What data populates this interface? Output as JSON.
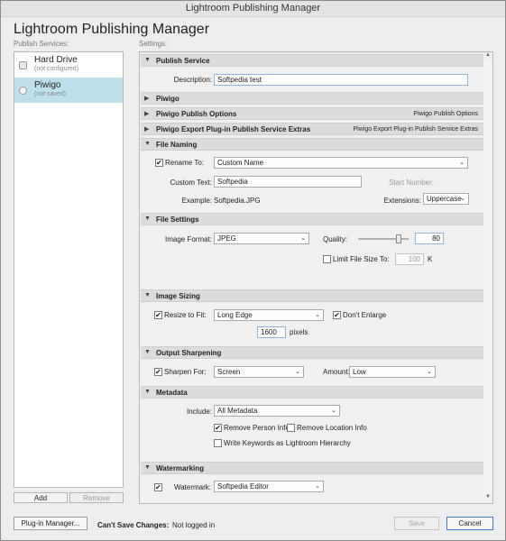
{
  "window": {
    "title": "Lightroom Publishing Manager",
    "close_glyph": "✕"
  },
  "app_title": "Lightroom Publishing Manager",
  "labels": {
    "publish_services": "Publish Services:",
    "settings": "Settings:"
  },
  "services": [
    {
      "name": "Hard Drive",
      "status": "(not configured)"
    },
    {
      "name": "Piwigo",
      "status": "(not saved)"
    }
  ],
  "left_buttons": {
    "add": "Add",
    "remove": "Remove"
  },
  "sections": {
    "publish_service": {
      "title": "Publish Service",
      "description_label": "Description:",
      "description_value": "Softpedia test"
    },
    "piwigo": {
      "title": "Piwigo"
    },
    "piwigo_publish_options": {
      "title": "Piwigo Publish Options",
      "right": "Piwigo Publish Options"
    },
    "piwigo_export_extras": {
      "title": "Piwigo Export Plug-in Publish Service Extras",
      "right": "Piwigo Export Plug-in Publish Service Extras"
    },
    "file_naming": {
      "title": "File Naming",
      "rename_label": "Rename To:",
      "rename_checked": "✔",
      "rename_value": "Custom Name",
      "custom_text_label": "Custom Text:",
      "custom_text_value": "Softpedia",
      "start_number_label": "Start Number:",
      "example_label": "Example:",
      "example_value": "Softpedia.JPG",
      "extensions_label": "Extensions:",
      "extensions_value": "Uppercase"
    },
    "file_settings": {
      "title": "File Settings",
      "format_label": "Image Format:",
      "format_value": "JPEG",
      "quality_label": "Quality:",
      "quality_value": "80",
      "quality_fraction": 0.8,
      "limit_label": "Limit File Size To:",
      "limit_value": "100",
      "limit_unit": "K"
    },
    "image_sizing": {
      "title": "Image Sizing",
      "resize_label": "Resize to Fit:",
      "resize_checked": "✔",
      "resize_value": "Long Edge",
      "dont_enlarge_label": "Don't Enlarge",
      "dont_enlarge_checked": "✔",
      "size_value": "1600",
      "size_unit": "pixels"
    },
    "output_sharpening": {
      "title": "Output Sharpening",
      "sharpen_label": "Sharpen For:",
      "sharpen_checked": "✔",
      "sharpen_value": "Screen",
      "amount_label": "Amount:",
      "amount_value": "Low"
    },
    "metadata": {
      "title": "Metadata",
      "include_label": "Include:",
      "include_value": "All Metadata",
      "remove_person_label": "Remove Person Info",
      "remove_person_checked": "✔",
      "remove_location_label": "Remove Location Info",
      "write_keywords_label": "Write Keywords as Lightroom Hierarchy"
    },
    "watermarking": {
      "title": "Watermarking",
      "watermark_label": "Watermark:",
      "watermark_checked": "✔",
      "watermark_value": "Softpedia Editor"
    }
  },
  "glyphs": {
    "expanded": "▼",
    "collapsed": "▶",
    "chevron": "⌄",
    "scroll_up": "▲",
    "scroll_down": "▼"
  },
  "bottom": {
    "plugin_manager": "Plug-in Manager...",
    "cant_save": "Can't Save Changes:",
    "not_logged_in": "Not logged in",
    "save": "Save",
    "cancel": "Cancel"
  },
  "colors": {
    "selection": "#bde0ec",
    "focus_border": "#8fb6d6",
    "section_header": "#dcdcdc"
  }
}
